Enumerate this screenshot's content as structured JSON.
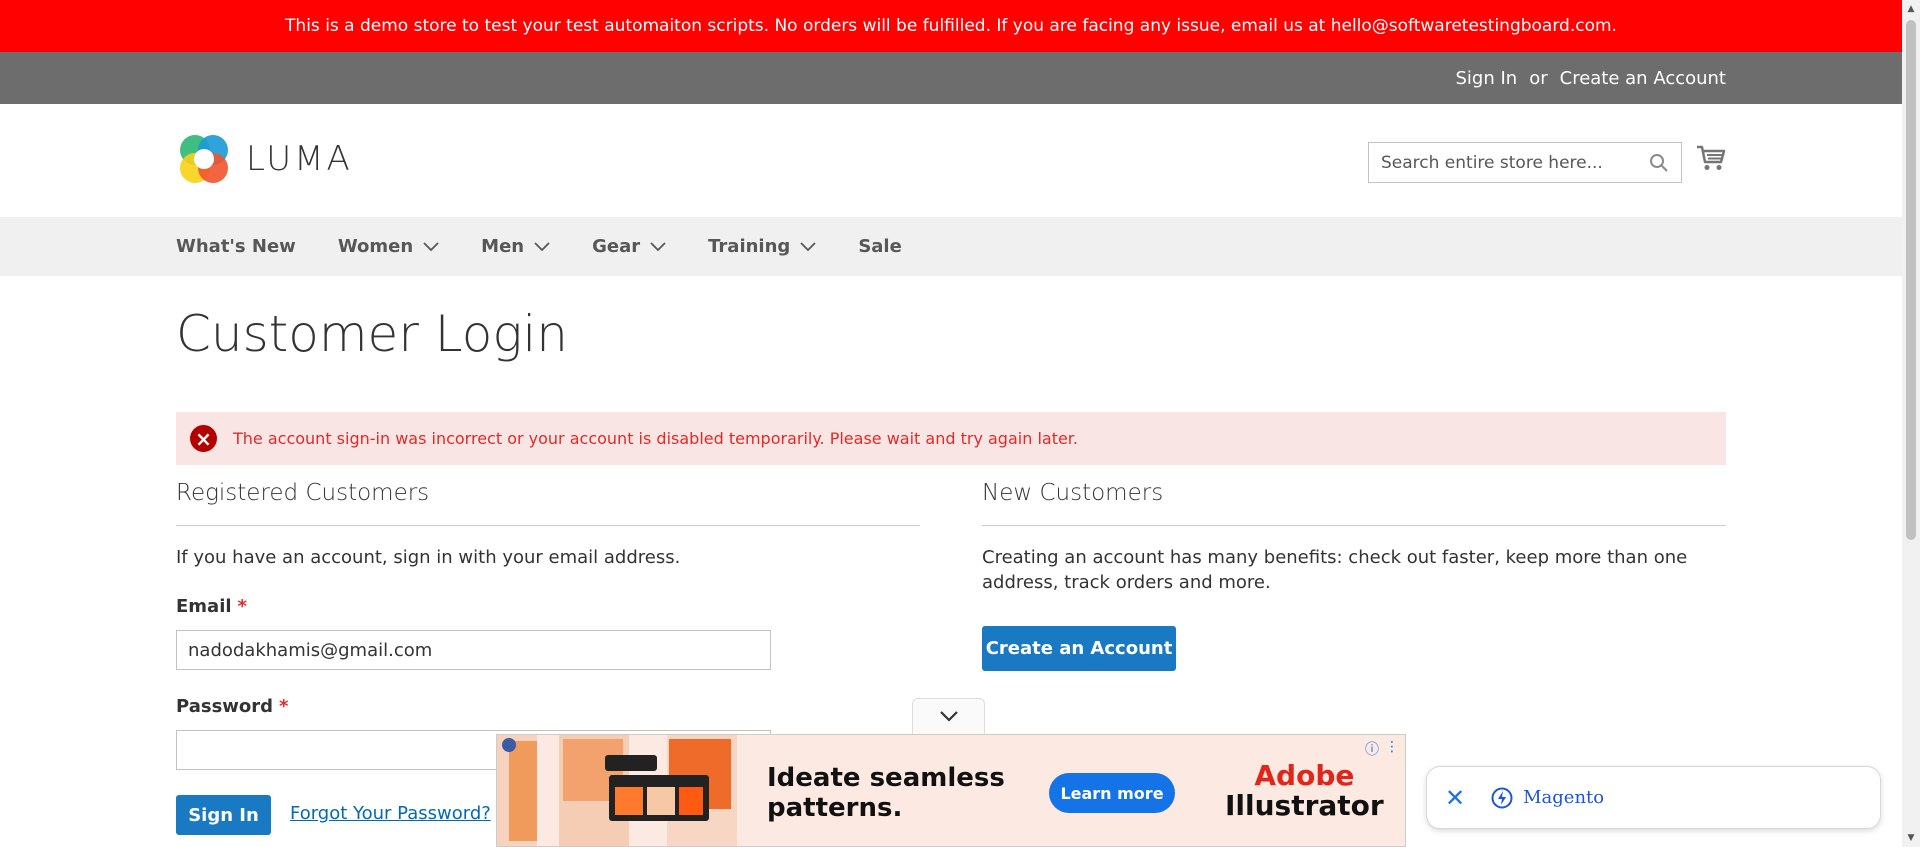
{
  "demo_notice": "This is a demo store to test your test automaiton scripts. No orders will be fulfilled. If you are facing any issue, email us at hello@softwaretestingboard.com.",
  "top_links": {
    "sign_in": "Sign In",
    "or": "or",
    "create_account": "Create an Account"
  },
  "logo": {
    "text": "LUMA"
  },
  "search": {
    "placeholder": "Search entire store here..."
  },
  "nav": [
    {
      "label": "What's New",
      "has_dropdown": false
    },
    {
      "label": "Women",
      "has_dropdown": true
    },
    {
      "label": "Men",
      "has_dropdown": true
    },
    {
      "label": "Gear",
      "has_dropdown": true
    },
    {
      "label": "Training",
      "has_dropdown": true
    },
    {
      "label": "Sale",
      "has_dropdown": false
    }
  ],
  "page_title": "Customer Login",
  "error_message": "The account sign-in was incorrect or your account is disabled temporarily. Please wait and try again later.",
  "registered": {
    "title": "Registered Customers",
    "intro": "If you have an account, sign in with your email address.",
    "email_label": "Email",
    "email_value": "nadodakhamis@gmail.com",
    "password_label": "Password",
    "required_mark": "*",
    "sign_in_button": "Sign In",
    "forgot_link": "Forgot Your Password?"
  },
  "new_customers": {
    "title": "New Customers",
    "intro": "Creating an account has many benefits: check out faster, keep more than one address, track orders and more.",
    "create_button": "Create an Account"
  },
  "ad": {
    "headline_line1": "Ideate seamless",
    "headline_line2": "patterns.",
    "cta": "Learn more",
    "brand_line1": "Adobe",
    "brand_line2": "Illustrator"
  },
  "toast": {
    "label": "Magento"
  },
  "colors": {
    "demo_bar": "#ff0101",
    "top_links_bar": "#6d6d6d",
    "nav_bar": "#f0f0f0",
    "primary_button": "#1979c3",
    "error_bg": "#fae5e5",
    "error_text": "#e02b27"
  }
}
